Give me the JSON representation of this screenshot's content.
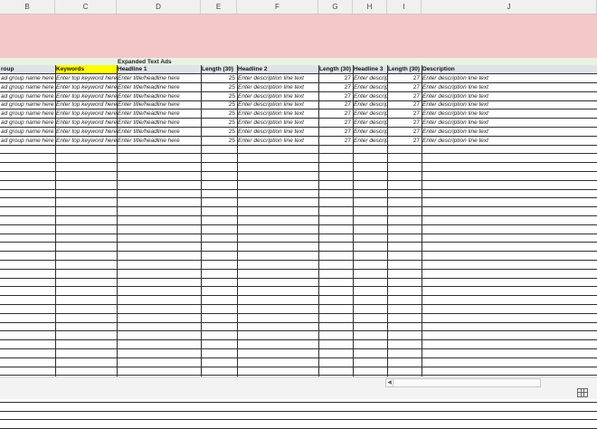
{
  "columns": [
    "B",
    "C",
    "D",
    "E",
    "F",
    "G",
    "H",
    "I",
    "J"
  ],
  "sheet": {
    "section_title": "Expanded Text Ads",
    "headers": [
      "roup",
      "Keywords",
      "Headline 1",
      "Length (30)",
      "Headline 2",
      "Length (30)",
      "Headline 3",
      "Length (30)",
      "Description"
    ],
    "rows": [
      [
        "ad group name here",
        "Enter top keyword here",
        "Enter title/headline here",
        "25",
        "Enter description line text",
        "27",
        "Enter descrip",
        "27",
        "Enter description line text"
      ],
      [
        "ad group name here",
        "Enter top keyword here",
        "Enter title/headline here",
        "25",
        "Enter description line text",
        "27",
        "Enter descrip",
        "27",
        "Enter description line text"
      ],
      [
        "ad group name here",
        "Enter top keyword here",
        "Enter title/headline here",
        "25",
        "Enter description line text",
        "27",
        "Enter descrip",
        "27",
        "Enter description line text"
      ],
      [
        "ad group name here",
        "Enter top keyword here",
        "Enter title/headline here",
        "25",
        "Enter description line text",
        "27",
        "Enter descrip",
        "27",
        "Enter description line text"
      ],
      [
        "ad group name here",
        "Enter top keyword here",
        "Enter title/headline here",
        "25",
        "Enter description line text",
        "27",
        "Enter descrip",
        "27",
        "Enter description line text"
      ],
      [
        "ad group name here",
        "Enter top keyword here",
        "Enter title/headline here",
        "25",
        "Enter description line text",
        "27",
        "Enter descrip",
        "27",
        "Enter description line text"
      ],
      [
        "ad group name here",
        "Enter top keyword here",
        "Enter title/headline here",
        "25",
        "Enter description line text",
        "27",
        "Enter descrip",
        "27",
        "Enter description line text"
      ],
      [
        "ad group name here",
        "Enter top keyword here",
        "Enter title/headline here",
        "25",
        "Enter description line text",
        "27",
        "Enter descrip",
        "27",
        "Enter description line text"
      ]
    ]
  },
  "colors": {
    "banner": "#f4c7c8",
    "keyword_header": "#ffff00",
    "header": "#dfe3e8",
    "title_band": "#e9f3e3"
  }
}
